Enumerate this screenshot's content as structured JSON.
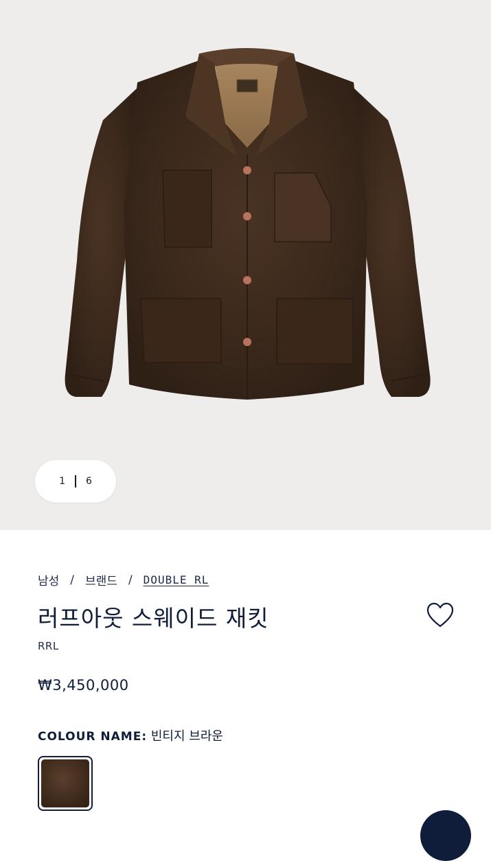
{
  "gallery": {
    "current": "1",
    "total": "6"
  },
  "breadcrumb": {
    "items": [
      "남성",
      "브랜드",
      "DOUBLE RL"
    ],
    "separator": "/"
  },
  "product": {
    "title": "러프아웃 스웨이드 재킷",
    "brand": "RRL",
    "price": "₩3,450,000",
    "colour_label": "COLOUR NAME:",
    "colour_value": "빈티지 브라운"
  },
  "icons": {
    "wishlist": "heart-outline-icon"
  },
  "colors": {
    "navy": "#0f1c3a",
    "gallery_bg": "#efedeb",
    "suede": "#3f2a1c"
  }
}
